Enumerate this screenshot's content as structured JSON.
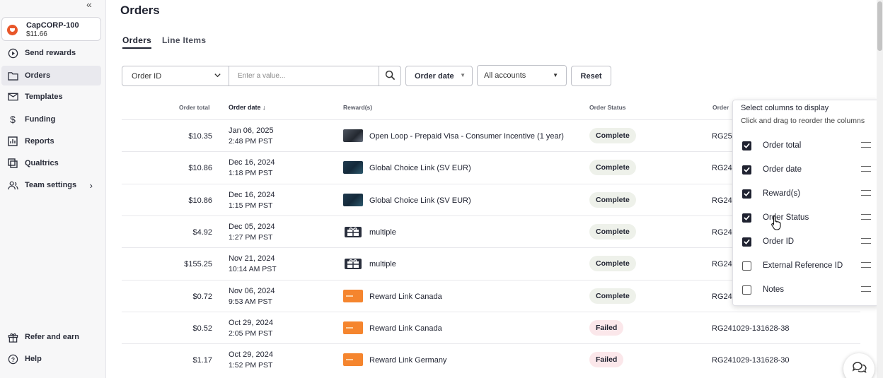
{
  "sidebar": {
    "collapse_glyph": "«",
    "account": {
      "name": "CapCORP-100",
      "balance": "$11.66"
    },
    "items": [
      {
        "label": "Send rewards",
        "icon": "send-icon"
      },
      {
        "label": "Orders",
        "icon": "folder-icon"
      },
      {
        "label": "Templates",
        "icon": "mail-icon"
      },
      {
        "label": "Funding",
        "icon": "dollar-icon"
      },
      {
        "label": "Reports",
        "icon": "chart-icon"
      },
      {
        "label": "Qualtrics",
        "icon": "qualtrics-icon"
      },
      {
        "label": "Team settings",
        "icon": "team-icon"
      }
    ],
    "bottom": [
      {
        "label": "Refer and earn",
        "icon": "gift-icon"
      },
      {
        "label": "Help",
        "icon": "help-icon"
      }
    ],
    "chevron": "›"
  },
  "page": {
    "title": "Orders"
  },
  "tabs": [
    {
      "label": "Orders"
    },
    {
      "label": "Line Items"
    }
  ],
  "filters": {
    "field_select": "Order ID",
    "search_placeholder": "Enter a value...",
    "date_button": "Order date",
    "accounts_select": "All accounts",
    "reset": "Reset"
  },
  "table": {
    "headers": {
      "total": "Order total",
      "date": "Order date",
      "sort_glyph": "↓",
      "rewards": "Reward(s)",
      "status": "Order Status",
      "order_id": "Order"
    },
    "rows": [
      {
        "total": "$10.35",
        "date": "Jan 06, 2025",
        "time": "2:48 PM PST",
        "reward": "Open Loop - Prepaid Visa - Consumer Incentive (1 year)",
        "thumb": "visa",
        "status": "Complete",
        "order_id": "RG25"
      },
      {
        "total": "$10.86",
        "date": "Dec 16, 2024",
        "time": "1:18 PM PST",
        "reward": "Global Choice Link (SV EUR)",
        "thumb": "global",
        "status": "Complete",
        "order_id": "RG24"
      },
      {
        "total": "$10.86",
        "date": "Dec 16, 2024",
        "time": "1:15 PM PST",
        "reward": "Global Choice Link (SV EUR)",
        "thumb": "global",
        "status": "Complete",
        "order_id": "RG24"
      },
      {
        "total": "$4.92",
        "date": "Dec 05, 2024",
        "time": "1:27 PM PST",
        "reward": "multiple",
        "thumb": "gift",
        "status": "Complete",
        "order_id": "RG24"
      },
      {
        "total": "$155.25",
        "date": "Nov 21, 2024",
        "time": "10:14 AM PST",
        "reward": "multiple",
        "thumb": "gift",
        "status": "Complete",
        "order_id": "RG24"
      },
      {
        "total": "$0.72",
        "date": "Nov 06, 2024",
        "time": "9:53 AM PST",
        "reward": "Reward Link Canada",
        "thumb": "orange",
        "status": "Complete",
        "order_id": "RG24"
      },
      {
        "total": "$0.52",
        "date": "Oct 29, 2024",
        "time": "2:05 PM PST",
        "reward": "Reward Link Canada",
        "thumb": "orange",
        "status": "Failed",
        "order_id": "RG241029-131628-38"
      },
      {
        "total": "$1.17",
        "date": "Oct 29, 2024",
        "time": "1:52 PM PST",
        "reward": "Reward Link Germany",
        "thumb": "orange",
        "status": "Failed",
        "order_id": "RG241029-131628-30"
      }
    ]
  },
  "column_panel": {
    "title": "Select columns to display",
    "subtitle": "Click and drag to reorder the columns",
    "options": [
      {
        "label": "Order total",
        "checked": true
      },
      {
        "label": "Order date",
        "checked": true
      },
      {
        "label": "Reward(s)",
        "checked": true
      },
      {
        "label": "Order Status",
        "checked": true
      },
      {
        "label": "Order ID",
        "checked": true
      },
      {
        "label": "External Reference ID",
        "checked": false
      },
      {
        "label": "Notes",
        "checked": false
      }
    ]
  },
  "colors": {
    "brand": "#e8572a",
    "complete_bg": "#eef1ea",
    "failed_bg": "#fbe7ea",
    "reward_link": "#f5852e"
  }
}
